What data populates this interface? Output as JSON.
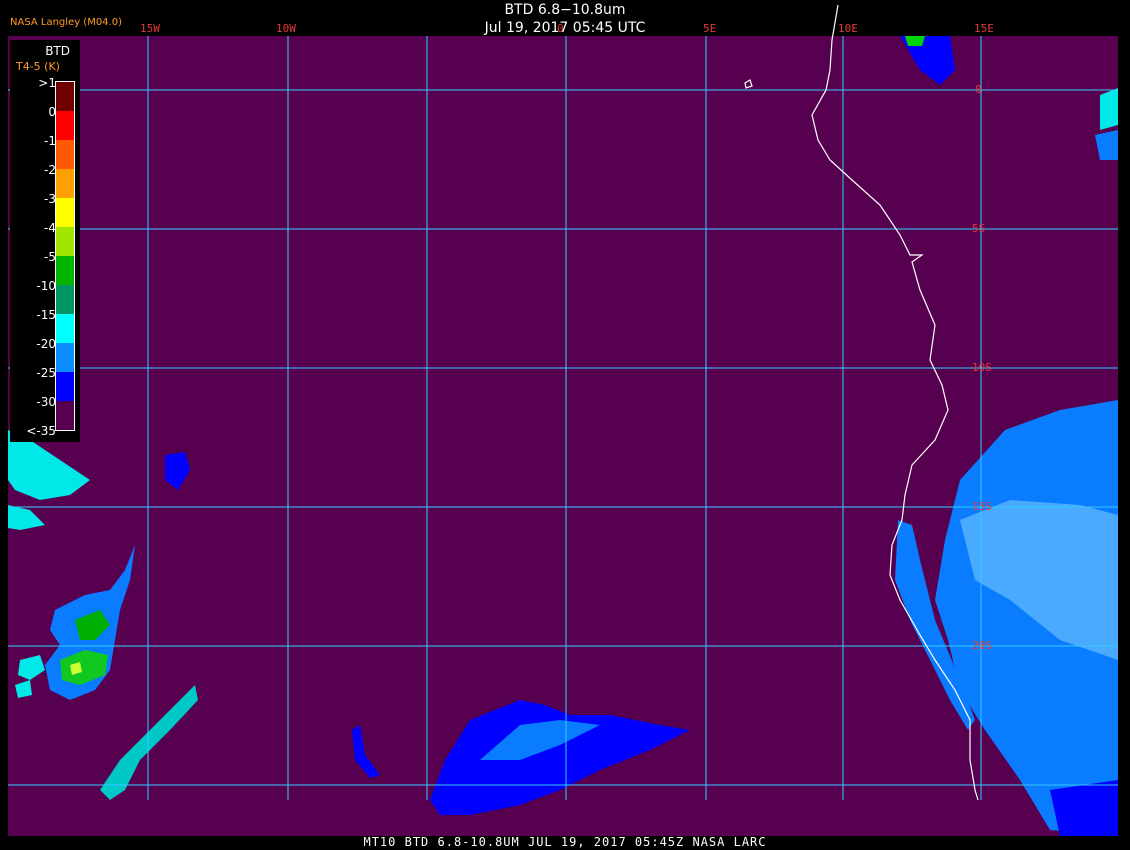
{
  "header": {
    "title": "BTD 6.8−10.8um",
    "datetime": "Jul 19, 2017 05:45 UTC",
    "producer": "NASA Langley (M04.0)"
  },
  "longitude_labels": [
    "15W",
    "10W",
    "0",
    "5E",
    "10E",
    "15E"
  ],
  "latitude_labels": [
    "0",
    "5S",
    "10S",
    "15S",
    "20S"
  ],
  "legend": {
    "title": "BTD",
    "subtitle": "T4-5 (K)",
    "items": [
      {
        "label": ">1",
        "color": "#6e0000"
      },
      {
        "label": "0",
        "color": "#ff0000"
      },
      {
        "label": "-1",
        "color": "#ff5a00"
      },
      {
        "label": "-2",
        "color": "#ffa000"
      },
      {
        "label": "-3",
        "color": "#ffff00"
      },
      {
        "label": "-4",
        "color": "#a0e600"
      },
      {
        "label": "-5",
        "color": "#00b400"
      },
      {
        "label": "-10",
        "color": "#009664"
      },
      {
        "label": "-15",
        "color": "#00ffff"
      },
      {
        "label": "-20",
        "color": "#0a8cff"
      },
      {
        "label": "-25",
        "color": "#0000ff"
      },
      {
        "label": "-30",
        "color": "#57004f"
      },
      {
        "label": "<-35",
        "color": "#57004f"
      }
    ]
  },
  "footer": "MT10  BTD 6.8-10.8UM  JUL 19, 2017 05:45Z  NASA LARC"
}
